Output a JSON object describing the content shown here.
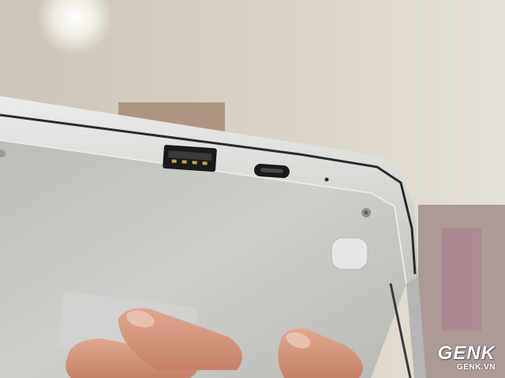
{
  "scene": {
    "description_tag": "laptop-underside-ports-photo",
    "colors": {
      "wall": "#d8d1c4",
      "aluminum": "#c9c9c6",
      "aluminum_edge": "#e4e4e2",
      "port_black": "#1a1a1a",
      "skin": "#d59a82"
    }
  },
  "watermark": {
    "main": "GENK",
    "sub": "GENK.VN"
  }
}
